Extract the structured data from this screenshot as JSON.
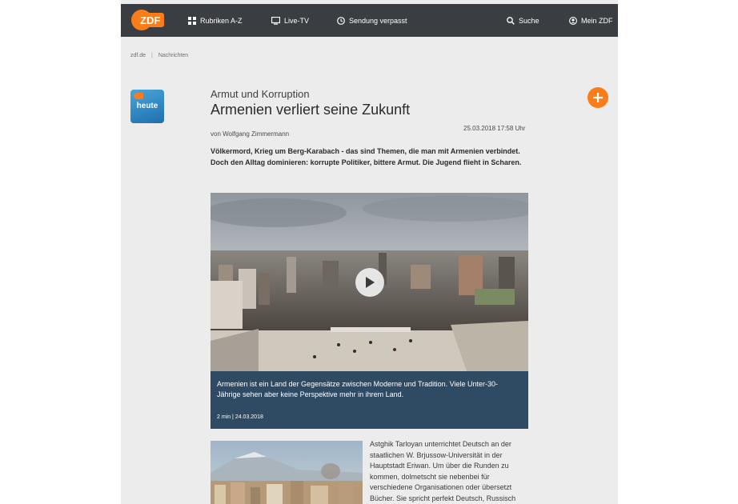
{
  "header": {
    "logo": "ZDF",
    "nav": [
      {
        "label": "Rubriken A-Z",
        "icon": "grid-icon"
      },
      {
        "label": "Live-TV",
        "icon": "tv-icon"
      },
      {
        "label": "Sendung verpasst",
        "icon": "clock-icon"
      },
      {
        "label": "Suche",
        "icon": "search-icon"
      },
      {
        "label": "Mein ZDF",
        "icon": "user-icon"
      }
    ]
  },
  "breadcrumb": {
    "items": [
      "zdf.de",
      "Nachrichten"
    ],
    "separator": "|"
  },
  "brand": {
    "logo": "heute"
  },
  "article": {
    "kicker": "Armut und Korruption",
    "title": "Armenien verliert seine Zukunft",
    "author": "von Wolfgang Zimmermann",
    "datetime": "25.03.2018 17:58 Uhr",
    "teaser": "Völkermord, Krieg um Berg-Karabach - das sind Themen, die man mit Armenien verbindet. Doch den Alltag dominieren: korrupte Politiker, bittere Armut. Die Jugend flieht in Scharen.",
    "video": {
      "caption": "Armenien ist ein Land der Gegensätze zwischen Moderne und Tradition. Viele Unter-30-Jährige sehen aber keine Perspektive mehr in ihrem Land.",
      "meta": "2 min | 24.03.2018"
    },
    "body": "Astghik Tarloyan unterrichtet Deutsch an der staatlichen W. Brjussow-Universität in der Hauptstadt Eriwan. Um über die Runden zu kommen, dolmetscht sie nebenbei für verschiedene Organisationen oder übersetzt Bücher. Sie spricht perfekt Deutsch, Russisch"
  },
  "colors": {
    "brand_orange": "#fa7d19",
    "navbar": "#3a3e42",
    "caption_bg": "#2f4a63",
    "page_bg": "#ececec"
  }
}
